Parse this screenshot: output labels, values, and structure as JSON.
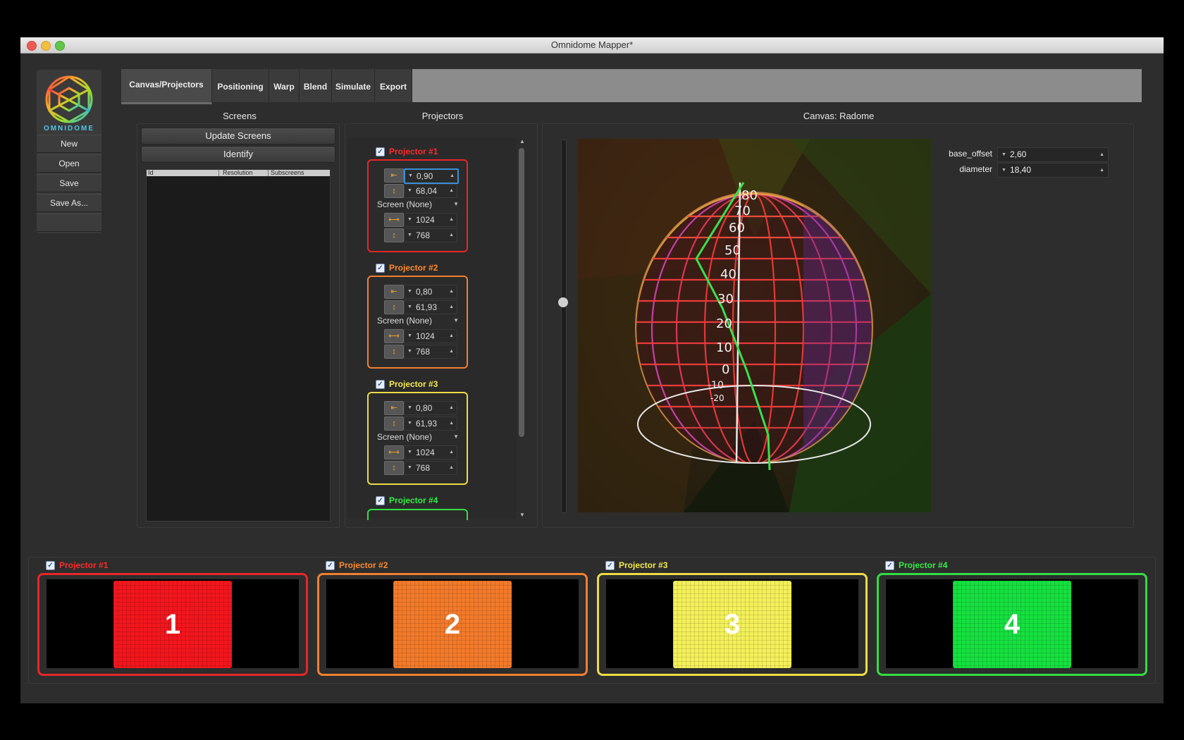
{
  "window": {
    "title": "Omnidome Mapper*"
  },
  "logo": {
    "text": "OMNIDOME"
  },
  "sidebar": {
    "buttons": [
      "New",
      "Open",
      "Save",
      "Save As...",
      ""
    ]
  },
  "tabs": [
    "Canvas/Projectors",
    "Positioning",
    "Warp",
    "Blend",
    "Simulate",
    "Export"
  ],
  "screens": {
    "title": "Screens",
    "update_label": "Update Screens",
    "identify_label": "Identify",
    "columns": [
      "Id",
      "Resolution",
      "Subscreens"
    ]
  },
  "projectors_panel": {
    "title": "Projectors",
    "screen_label": "Screen",
    "projectors": [
      {
        "name": "Projector #1",
        "color": "#ff2a2a",
        "angle": "0,90",
        "fov": "68,04",
        "screen": "(None)",
        "width": "1024",
        "height": "768"
      },
      {
        "name": "Projector #2",
        "color": "#ff8a2a",
        "angle": "0,80",
        "fov": "61,93",
        "screen": "(None)",
        "width": "1024",
        "height": "768"
      },
      {
        "name": "Projector #3",
        "color": "#f4ea4a",
        "angle": "0,80",
        "fov": "61,93",
        "screen": "(None)",
        "width": "1024",
        "height": "768"
      },
      {
        "name": "Projector #4",
        "color": "#33ee44"
      }
    ]
  },
  "canvas": {
    "title": "Canvas: Radome",
    "params": [
      {
        "label": "base_offset",
        "value": "2,60"
      },
      {
        "label": "diameter",
        "value": "18,40"
      }
    ],
    "latitude_labels": [
      "80",
      "70",
      "60",
      "50",
      "40",
      "30",
      "20",
      "10",
      "0",
      "-10",
      "-20"
    ]
  },
  "previews": [
    {
      "name": "Projector #1",
      "number": "1",
      "color": "#ff2a2a",
      "fill": "#f2161d"
    },
    {
      "name": "Projector #2",
      "number": "2",
      "color": "#ff7a2a",
      "fill": "#f27a2a"
    },
    {
      "name": "Projector #3",
      "number": "3",
      "color": "#f4e24a",
      "fill": "#f4f05a"
    },
    {
      "name": "Projector #4",
      "number": "4",
      "color": "#33ee44",
      "fill": "#16e040"
    }
  ]
}
